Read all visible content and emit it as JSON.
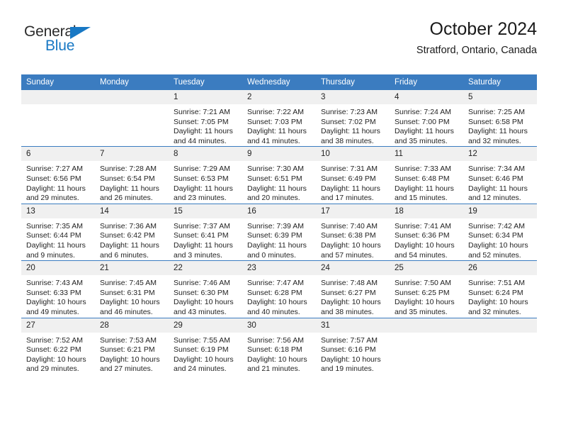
{
  "brand": {
    "name_top": "General",
    "name_bottom": "Blue",
    "accent_color": "#1878c4"
  },
  "header": {
    "title": "October 2024",
    "subtitle": "Stratford, Ontario, Canada"
  },
  "colors": {
    "header_band": "#3b7cc0",
    "daynum_band": "#f0f0f0",
    "row_divider": "#3b7cc0",
    "text": "#232323"
  },
  "weekday_headers": [
    "Sunday",
    "Monday",
    "Tuesday",
    "Wednesday",
    "Thursday",
    "Friday",
    "Saturday"
  ],
  "weeks": [
    [
      {
        "day": "",
        "sunrise": "",
        "sunset": "",
        "daylight_1": "",
        "daylight_2": ""
      },
      {
        "day": "",
        "sunrise": "",
        "sunset": "",
        "daylight_1": "",
        "daylight_2": ""
      },
      {
        "day": "1",
        "sunrise": "Sunrise: 7:21 AM",
        "sunset": "Sunset: 7:05 PM",
        "daylight_1": "Daylight: 11 hours",
        "daylight_2": "and 44 minutes."
      },
      {
        "day": "2",
        "sunrise": "Sunrise: 7:22 AM",
        "sunset": "Sunset: 7:03 PM",
        "daylight_1": "Daylight: 11 hours",
        "daylight_2": "and 41 minutes."
      },
      {
        "day": "3",
        "sunrise": "Sunrise: 7:23 AM",
        "sunset": "Sunset: 7:02 PM",
        "daylight_1": "Daylight: 11 hours",
        "daylight_2": "and 38 minutes."
      },
      {
        "day": "4",
        "sunrise": "Sunrise: 7:24 AM",
        "sunset": "Sunset: 7:00 PM",
        "daylight_1": "Daylight: 11 hours",
        "daylight_2": "and 35 minutes."
      },
      {
        "day": "5",
        "sunrise": "Sunrise: 7:25 AM",
        "sunset": "Sunset: 6:58 PM",
        "daylight_1": "Daylight: 11 hours",
        "daylight_2": "and 32 minutes."
      }
    ],
    [
      {
        "day": "6",
        "sunrise": "Sunrise: 7:27 AM",
        "sunset": "Sunset: 6:56 PM",
        "daylight_1": "Daylight: 11 hours",
        "daylight_2": "and 29 minutes."
      },
      {
        "day": "7",
        "sunrise": "Sunrise: 7:28 AM",
        "sunset": "Sunset: 6:54 PM",
        "daylight_1": "Daylight: 11 hours",
        "daylight_2": "and 26 minutes."
      },
      {
        "day": "8",
        "sunrise": "Sunrise: 7:29 AM",
        "sunset": "Sunset: 6:53 PM",
        "daylight_1": "Daylight: 11 hours",
        "daylight_2": "and 23 minutes."
      },
      {
        "day": "9",
        "sunrise": "Sunrise: 7:30 AM",
        "sunset": "Sunset: 6:51 PM",
        "daylight_1": "Daylight: 11 hours",
        "daylight_2": "and 20 minutes."
      },
      {
        "day": "10",
        "sunrise": "Sunrise: 7:31 AM",
        "sunset": "Sunset: 6:49 PM",
        "daylight_1": "Daylight: 11 hours",
        "daylight_2": "and 17 minutes."
      },
      {
        "day": "11",
        "sunrise": "Sunrise: 7:33 AM",
        "sunset": "Sunset: 6:48 PM",
        "daylight_1": "Daylight: 11 hours",
        "daylight_2": "and 15 minutes."
      },
      {
        "day": "12",
        "sunrise": "Sunrise: 7:34 AM",
        "sunset": "Sunset: 6:46 PM",
        "daylight_1": "Daylight: 11 hours",
        "daylight_2": "and 12 minutes."
      }
    ],
    [
      {
        "day": "13",
        "sunrise": "Sunrise: 7:35 AM",
        "sunset": "Sunset: 6:44 PM",
        "daylight_1": "Daylight: 11 hours",
        "daylight_2": "and 9 minutes."
      },
      {
        "day": "14",
        "sunrise": "Sunrise: 7:36 AM",
        "sunset": "Sunset: 6:42 PM",
        "daylight_1": "Daylight: 11 hours",
        "daylight_2": "and 6 minutes."
      },
      {
        "day": "15",
        "sunrise": "Sunrise: 7:37 AM",
        "sunset": "Sunset: 6:41 PM",
        "daylight_1": "Daylight: 11 hours",
        "daylight_2": "and 3 minutes."
      },
      {
        "day": "16",
        "sunrise": "Sunrise: 7:39 AM",
        "sunset": "Sunset: 6:39 PM",
        "daylight_1": "Daylight: 11 hours",
        "daylight_2": "and 0 minutes."
      },
      {
        "day": "17",
        "sunrise": "Sunrise: 7:40 AM",
        "sunset": "Sunset: 6:38 PM",
        "daylight_1": "Daylight: 10 hours",
        "daylight_2": "and 57 minutes."
      },
      {
        "day": "18",
        "sunrise": "Sunrise: 7:41 AM",
        "sunset": "Sunset: 6:36 PM",
        "daylight_1": "Daylight: 10 hours",
        "daylight_2": "and 54 minutes."
      },
      {
        "day": "19",
        "sunrise": "Sunrise: 7:42 AM",
        "sunset": "Sunset: 6:34 PM",
        "daylight_1": "Daylight: 10 hours",
        "daylight_2": "and 52 minutes."
      }
    ],
    [
      {
        "day": "20",
        "sunrise": "Sunrise: 7:43 AM",
        "sunset": "Sunset: 6:33 PM",
        "daylight_1": "Daylight: 10 hours",
        "daylight_2": "and 49 minutes."
      },
      {
        "day": "21",
        "sunrise": "Sunrise: 7:45 AM",
        "sunset": "Sunset: 6:31 PM",
        "daylight_1": "Daylight: 10 hours",
        "daylight_2": "and 46 minutes."
      },
      {
        "day": "22",
        "sunrise": "Sunrise: 7:46 AM",
        "sunset": "Sunset: 6:30 PM",
        "daylight_1": "Daylight: 10 hours",
        "daylight_2": "and 43 minutes."
      },
      {
        "day": "23",
        "sunrise": "Sunrise: 7:47 AM",
        "sunset": "Sunset: 6:28 PM",
        "daylight_1": "Daylight: 10 hours",
        "daylight_2": "and 40 minutes."
      },
      {
        "day": "24",
        "sunrise": "Sunrise: 7:48 AM",
        "sunset": "Sunset: 6:27 PM",
        "daylight_1": "Daylight: 10 hours",
        "daylight_2": "and 38 minutes."
      },
      {
        "day": "25",
        "sunrise": "Sunrise: 7:50 AM",
        "sunset": "Sunset: 6:25 PM",
        "daylight_1": "Daylight: 10 hours",
        "daylight_2": "and 35 minutes."
      },
      {
        "day": "26",
        "sunrise": "Sunrise: 7:51 AM",
        "sunset": "Sunset: 6:24 PM",
        "daylight_1": "Daylight: 10 hours",
        "daylight_2": "and 32 minutes."
      }
    ],
    [
      {
        "day": "27",
        "sunrise": "Sunrise: 7:52 AM",
        "sunset": "Sunset: 6:22 PM",
        "daylight_1": "Daylight: 10 hours",
        "daylight_2": "and 29 minutes."
      },
      {
        "day": "28",
        "sunrise": "Sunrise: 7:53 AM",
        "sunset": "Sunset: 6:21 PM",
        "daylight_1": "Daylight: 10 hours",
        "daylight_2": "and 27 minutes."
      },
      {
        "day": "29",
        "sunrise": "Sunrise: 7:55 AM",
        "sunset": "Sunset: 6:19 PM",
        "daylight_1": "Daylight: 10 hours",
        "daylight_2": "and 24 minutes."
      },
      {
        "day": "30",
        "sunrise": "Sunrise: 7:56 AM",
        "sunset": "Sunset: 6:18 PM",
        "daylight_1": "Daylight: 10 hours",
        "daylight_2": "and 21 minutes."
      },
      {
        "day": "31",
        "sunrise": "Sunrise: 7:57 AM",
        "sunset": "Sunset: 6:16 PM",
        "daylight_1": "Daylight: 10 hours",
        "daylight_2": "and 19 minutes."
      },
      {
        "day": "",
        "sunrise": "",
        "sunset": "",
        "daylight_1": "",
        "daylight_2": ""
      },
      {
        "day": "",
        "sunrise": "",
        "sunset": "",
        "daylight_1": "",
        "daylight_2": ""
      }
    ]
  ]
}
